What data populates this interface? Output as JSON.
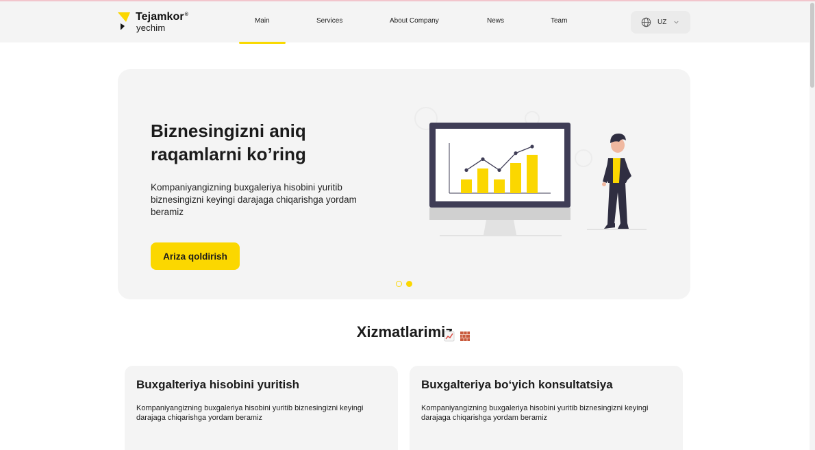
{
  "header": {
    "logo_title": "Tejamkor",
    "logo_reg": "®",
    "logo_sub": "yechim",
    "nav": [
      {
        "label": "Main"
      },
      {
        "label": "Services"
      },
      {
        "label": "About Company"
      },
      {
        "label": "News"
      },
      {
        "label": "Team"
      }
    ],
    "active_nav": "Main",
    "language": "UZ"
  },
  "hero": {
    "title": "Biznesingizni aniq raqamlarni ko’ring",
    "text": "Kompaniyangizning buxgaleriya hisobini yuritib biznesingizni keyingi darajaga chiqarishga yordam beramiz",
    "button_label": "Ariza qoldirish",
    "slides": 2,
    "active_slide": 2,
    "chart_bars": [
      0.25,
      0.45,
      0.25,
      0.55,
      0.7
    ],
    "chart_line": [
      0.42,
      0.62,
      0.42,
      0.73,
      0.85
    ]
  },
  "services": {
    "title": "Xizmatlarimiz",
    "emoji": [
      "chart-increasing-emoji",
      "bricks-emoji"
    ],
    "cards": [
      {
        "title": "Buxgalteriya hisobini yuritish",
        "text": "Kompaniyangizning buxgaleriya hisobini yuritib biznesingizni keyingi darajaga chiqarishga yordam beramiz"
      },
      {
        "title": "Buxgalteriya bo‘yich konsultatsiya",
        "text": "Kompaniyangizning buxgaleriya hisobini yuritib biznesingizni keyingi darajaga chiqarishga yordam beramiz"
      }
    ]
  },
  "colors": {
    "accent": "#fbd700",
    "panel": "#f4f4f4",
    "monitor": "#3f3d56",
    "text": "#1b1b1b"
  }
}
